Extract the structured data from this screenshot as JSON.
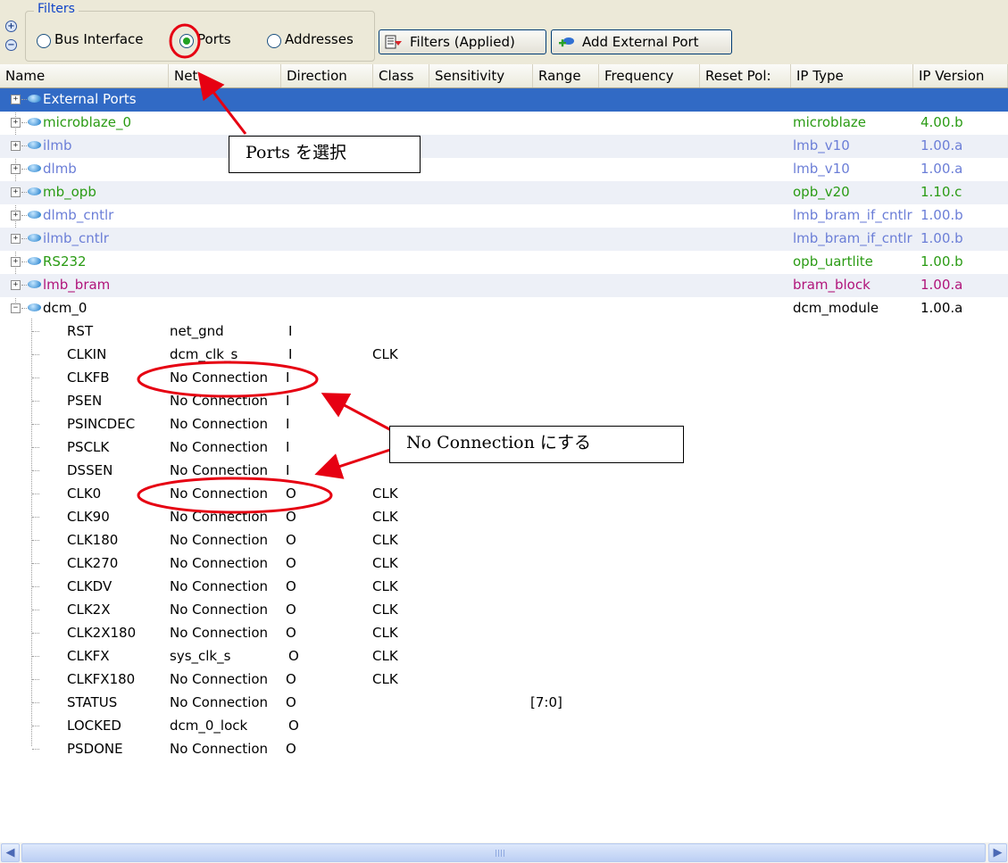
{
  "filters": {
    "legend": "Filters",
    "radios": [
      {
        "label": "Bus Interface",
        "checked": false
      },
      {
        "label": "Ports",
        "checked": true
      },
      {
        "label": "Addresses",
        "checked": false
      }
    ],
    "buttons": {
      "filters_applied": "Filters (Applied)",
      "add_external_port": "Add External Port"
    }
  },
  "columns": [
    "Name",
    "Net",
    "Direction",
    "Class",
    "Sensitivity",
    "Range",
    "Frequency",
    "Reset Pol:",
    "IP Type",
    "IP Version"
  ],
  "instances": [
    {
      "name": "External Ports",
      "ip_type": "",
      "ip_version": "",
      "color": "#ffffff",
      "icon": "external-ports-icon",
      "expander": "+"
    },
    {
      "name": "microblaze_0",
      "ip_type": "microblaze",
      "ip_version": "4.00.b",
      "color": "#2a9b14",
      "icon": "ip-instance-icon",
      "expander": "+"
    },
    {
      "name": "ilmb",
      "ip_type": "lmb_v10",
      "ip_version": "1.00.a",
      "color": "#6b7ed7",
      "icon": "ip-instance-icon",
      "expander": "+"
    },
    {
      "name": "dlmb",
      "ip_type": "lmb_v10",
      "ip_version": "1.00.a",
      "color": "#6b7ed7",
      "icon": "ip-instance-icon",
      "expander": "+"
    },
    {
      "name": "mb_opb",
      "ip_type": "opb_v20",
      "ip_version": "1.10.c",
      "color": "#2a9b14",
      "icon": "ip-instance-icon",
      "expander": "+"
    },
    {
      "name": "dlmb_cntlr",
      "ip_type": "lmb_bram_if_cntlr",
      "ip_version": "1.00.b",
      "color": "#6b7ed7",
      "icon": "ip-instance-icon",
      "expander": "+"
    },
    {
      "name": "ilmb_cntlr",
      "ip_type": "lmb_bram_if_cntlr",
      "ip_version": "1.00.b",
      "color": "#6b7ed7",
      "icon": "ip-instance-icon",
      "expander": "+"
    },
    {
      "name": "RS232",
      "ip_type": "opb_uartlite",
      "ip_version": "1.00.b",
      "color": "#2a9b14",
      "icon": "ip-instance-icon",
      "expander": "+"
    },
    {
      "name": "lmb_bram",
      "ip_type": "bram_block",
      "ip_version": "1.00.a",
      "color": "#b0147a",
      "icon": "ip-instance-icon",
      "expander": "+"
    },
    {
      "name": "dcm_0",
      "ip_type": "dcm_module",
      "ip_version": "1.00.a",
      "color": "#000000",
      "icon": "ip-instance-icon",
      "expander": "−"
    }
  ],
  "ports": [
    {
      "name": "RST",
      "net": "net_gnd",
      "dir": "I",
      "class": "",
      "range": ""
    },
    {
      "name": "CLKIN",
      "net": "dcm_clk_s",
      "dir": "I",
      "class": "CLK",
      "range": ""
    },
    {
      "name": "CLKFB",
      "net": "No Connection",
      "dir": "I",
      "class": "",
      "range": ""
    },
    {
      "name": "PSEN",
      "net": "No Connection",
      "dir": "I",
      "class": "",
      "range": ""
    },
    {
      "name": "PSINCDEC",
      "net": "No Connection",
      "dir": "I",
      "class": "",
      "range": ""
    },
    {
      "name": "PSCLK",
      "net": "No Connection",
      "dir": "I",
      "class": "",
      "range": ""
    },
    {
      "name": "DSSEN",
      "net": "No Connection",
      "dir": "I",
      "class": "",
      "range": ""
    },
    {
      "name": "CLK0",
      "net": "No Connection",
      "dir": "O",
      "class": "CLK",
      "range": ""
    },
    {
      "name": "CLK90",
      "net": "No Connection",
      "dir": "O",
      "class": "CLK",
      "range": ""
    },
    {
      "name": "CLK180",
      "net": "No Connection",
      "dir": "O",
      "class": "CLK",
      "range": ""
    },
    {
      "name": "CLK270",
      "net": "No Connection",
      "dir": "O",
      "class": "CLK",
      "range": ""
    },
    {
      "name": "CLKDV",
      "net": "No Connection",
      "dir": "O",
      "class": "CLK",
      "range": ""
    },
    {
      "name": "CLK2X",
      "net": "No Connection",
      "dir": "O",
      "class": "CLK",
      "range": ""
    },
    {
      "name": "CLK2X180",
      "net": "No Connection",
      "dir": "O",
      "class": "CLK",
      "range": ""
    },
    {
      "name": "CLKFX",
      "net": "sys_clk_s",
      "dir": "O",
      "class": "CLK",
      "range": ""
    },
    {
      "name": "CLKFX180",
      "net": "No Connection",
      "dir": "O",
      "class": "CLK",
      "range": ""
    },
    {
      "name": "STATUS",
      "net": "No Connection",
      "dir": "O",
      "class": "",
      "range": "[7:0]"
    },
    {
      "name": "LOCKED",
      "net": "dcm_0_lock",
      "dir": "O",
      "class": "",
      "range": ""
    },
    {
      "name": "PSDONE",
      "net": "No Connection",
      "dir": "O",
      "class": "",
      "range": ""
    }
  ],
  "annotations": {
    "ports_callout": "Ports を選択",
    "no_connection_callout": "No Connection にする",
    "highlight_color": "#e60012"
  }
}
